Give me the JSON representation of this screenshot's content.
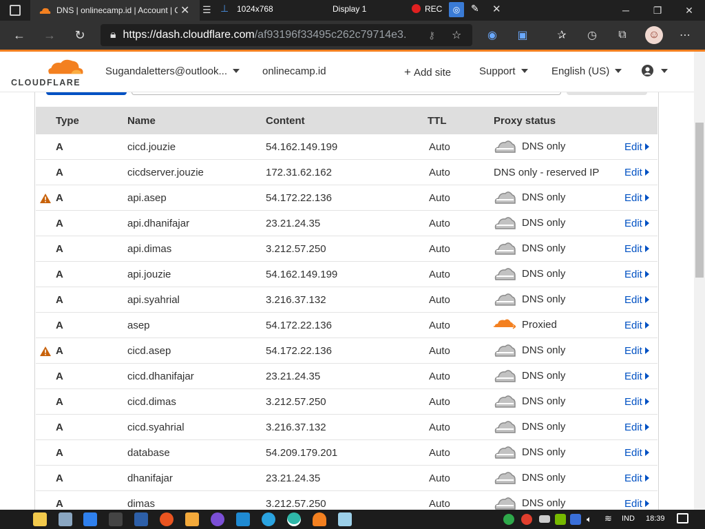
{
  "tab": {
    "title": "DNS | onlinecamp.id | Account | C",
    "close": "✕"
  },
  "record_bar": {
    "display_size": "1024x768",
    "display_name": "Display 1",
    "rec": "REC"
  },
  "address_bar": {
    "host": "https://dash.cloudflare.com",
    "path": "/af93196f33495c262c79714e3..."
  },
  "header": {
    "logo_text": "CLOUDFLARE",
    "account": "Sugandaletters@outlook...",
    "domain": "onlinecamp.id",
    "add_site": "Add site",
    "support": "Support",
    "language": "English (US)"
  },
  "table": {
    "headers": {
      "type": "Type",
      "name": "Name",
      "content": "Content",
      "ttl": "TTL",
      "proxy": "Proxy status"
    },
    "edit_label": "Edit",
    "rows": [
      {
        "type": "A",
        "name": "cicd.jouzie",
        "content": "54.162.149.199",
        "ttl": "Auto",
        "proxy": "DNS only",
        "proxy_icon": "grey-cloud",
        "warning": false
      },
      {
        "type": "A",
        "name": "cicdserver.jouzie",
        "content": "172.31.62.162",
        "ttl": "Auto",
        "proxy": "DNS only - reserved IP",
        "proxy_icon": "none",
        "warning": false
      },
      {
        "type": "A",
        "name": "api.asep",
        "content": "54.172.22.136",
        "ttl": "Auto",
        "proxy": "DNS only",
        "proxy_icon": "grey-cloud",
        "warning": true
      },
      {
        "type": "A",
        "name": "api.dhanifajar",
        "content": "23.21.24.35",
        "ttl": "Auto",
        "proxy": "DNS only",
        "proxy_icon": "grey-cloud",
        "warning": false
      },
      {
        "type": "A",
        "name": "api.dimas",
        "content": "3.212.57.250",
        "ttl": "Auto",
        "proxy": "DNS only",
        "proxy_icon": "grey-cloud",
        "warning": false
      },
      {
        "type": "A",
        "name": "api.jouzie",
        "content": "54.162.149.199",
        "ttl": "Auto",
        "proxy": "DNS only",
        "proxy_icon": "grey-cloud",
        "warning": false
      },
      {
        "type": "A",
        "name": "api.syahrial",
        "content": "3.216.37.132",
        "ttl": "Auto",
        "proxy": "DNS only",
        "proxy_icon": "grey-cloud",
        "warning": false
      },
      {
        "type": "A",
        "name": "asep",
        "content": "54.172.22.136",
        "ttl": "Auto",
        "proxy": "Proxied",
        "proxy_icon": "orange-cloud",
        "warning": false
      },
      {
        "type": "A",
        "name": "cicd.asep",
        "content": "54.172.22.136",
        "ttl": "Auto",
        "proxy": "DNS only",
        "proxy_icon": "grey-cloud",
        "warning": true
      },
      {
        "type": "A",
        "name": "cicd.dhanifajar",
        "content": "23.21.24.35",
        "ttl": "Auto",
        "proxy": "DNS only",
        "proxy_icon": "grey-cloud",
        "warning": false
      },
      {
        "type": "A",
        "name": "cicd.dimas",
        "content": "3.212.57.250",
        "ttl": "Auto",
        "proxy": "DNS only",
        "proxy_icon": "grey-cloud",
        "warning": false
      },
      {
        "type": "A",
        "name": "cicd.syahrial",
        "content": "3.216.37.132",
        "ttl": "Auto",
        "proxy": "DNS only",
        "proxy_icon": "grey-cloud",
        "warning": false
      },
      {
        "type": "A",
        "name": "database",
        "content": "54.209.179.201",
        "ttl": "Auto",
        "proxy": "DNS only",
        "proxy_icon": "grey-cloud",
        "warning": false
      },
      {
        "type": "A",
        "name": "dhanifajar",
        "content": "23.21.24.35",
        "ttl": "Auto",
        "proxy": "DNS only",
        "proxy_icon": "grey-cloud",
        "warning": false
      },
      {
        "type": "A",
        "name": "dimas",
        "content": "3.212.57.250",
        "ttl": "Auto",
        "proxy": "DNS only",
        "proxy_icon": "grey-cloud",
        "warning": false
      }
    ]
  },
  "taskbar": {
    "lang": "IND",
    "time": "18:39"
  },
  "colors": {
    "accent": "#f38020",
    "link": "#0051c3",
    "warning": "#c8620a"
  }
}
